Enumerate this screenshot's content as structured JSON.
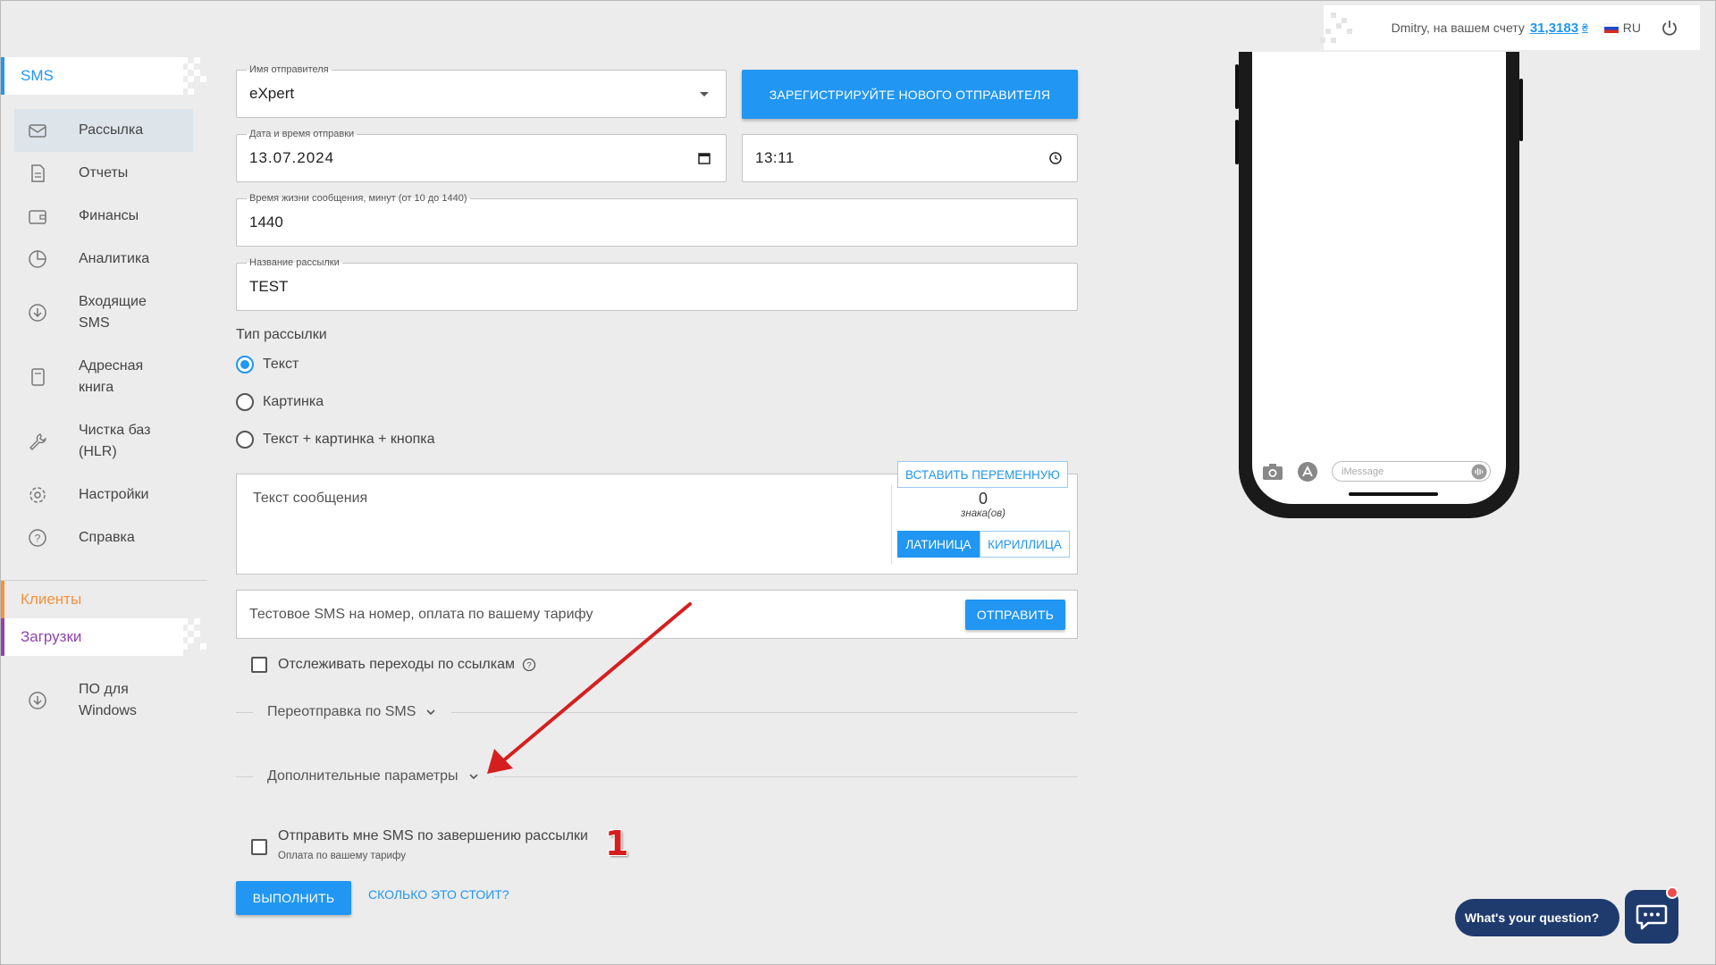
{
  "topbar": {
    "user_text": "Dmitry, на вашем счету",
    "balance": "31,3183",
    "currency": "₴",
    "lang": "RU"
  },
  "sidebar": {
    "sms_header": "SMS",
    "items": [
      {
        "label": "Рассылка",
        "icon": "envelope-icon"
      },
      {
        "label": "Отчеты",
        "icon": "document-icon"
      },
      {
        "label": "Финансы",
        "icon": "wallet-icon"
      },
      {
        "label": "Аналитика",
        "icon": "pie-chart-icon"
      },
      {
        "label": "Входящие SMS",
        "icon": "download-icon"
      },
      {
        "label": "Адресная книга",
        "icon": "book-icon"
      },
      {
        "label": "Чистка баз (HLR)",
        "icon": "wrench-icon"
      },
      {
        "label": "Настройки",
        "icon": "gear-icon"
      },
      {
        "label": "Справка",
        "icon": "question-icon"
      }
    ],
    "clients_header": "Клиенты",
    "downloads_header": "Загрузки",
    "software_item": "ПО для Windows"
  },
  "form": {
    "sender_label": "Имя отправителя",
    "sender_value": "eXpert",
    "register_button": "ЗАРЕГИСТРИРУЙТЕ НОВОГО ОТПРАВИТЕЛЯ",
    "datetime_label": "Дата и время отправки",
    "date_value": "13.07.2024",
    "time_value": "13:11",
    "lifetime_label": "Время жизни сообщения, минут (от 10 до 1440)",
    "lifetime_value": "1440",
    "name_label": "Название рассылки",
    "name_value": "TEST",
    "type_title": "Тип рассылки",
    "type_options": [
      "Текст",
      "Картинка",
      "Текст + картинка + кнопка"
    ],
    "type_selected": 0,
    "message_placeholder": "Текст сообщения",
    "insert_variable": "ВСТАВИТЬ ПЕРЕМЕННУЮ",
    "char_count": "0",
    "char_label": "знака(ов)",
    "latin": "ЛАТИНИЦА",
    "cyrillic": "КИРИЛЛИЦА",
    "test_placeholder": "Тестовое SMS на номер, оплата по вашему тарифу",
    "send_button": "ОТПРАВИТЬ",
    "track_links": "Отслеживать переходы по ссылкам",
    "resend": "Переотправка по SMS",
    "extra_params": "Дополнительные параметры",
    "notify_me": "Отправить мне SMS по завершению рассылки",
    "notify_note": "Оплата по вашему тарифу",
    "execute_button": "ВЫПОЛНИТЬ",
    "cost_link": "СКОЛЬКО ЭТО СТОИТ?"
  },
  "annotation": {
    "number": "1",
    "color": "#d51f1f"
  },
  "phone": {
    "imessage_placeholder": "iMessage"
  },
  "chat": {
    "prompt": "What's your question?"
  },
  "colors": {
    "accent": "#2196f3",
    "sms_bar": "#2196f3",
    "clients": "#f7913d",
    "downloads": "#8e44ad",
    "chat": "#1f3b6e"
  }
}
